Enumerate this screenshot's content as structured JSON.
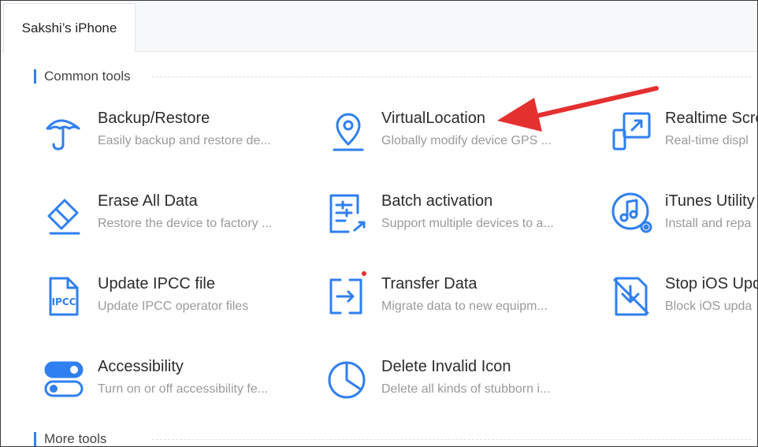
{
  "tab": {
    "label": "Sakshi’s iPhone"
  },
  "sections": {
    "common": "Common tools",
    "more": "More tools"
  },
  "colors": {
    "accent": "#2f7ff0",
    "arrow": "#e53030",
    "badge": "#e53030"
  },
  "tools": [
    {
      "title": "Backup/Restore",
      "desc": "Easily backup and restore de...",
      "icon": "umbrella-icon"
    },
    {
      "title": "VirtualLocation",
      "desc": "Globally modify device GPS ...",
      "icon": "location-pin-icon"
    },
    {
      "title": "Realtime Scre",
      "desc": "Real-time displ",
      "icon": "screen-mirror-icon"
    },
    {
      "title": "Erase All Data",
      "desc": "Restore the device to factory ...",
      "icon": "eraser-icon"
    },
    {
      "title": "Batch activation",
      "desc": "Support multiple devices to a...",
      "icon": "batch-activation-icon"
    },
    {
      "title": "iTunes Utility",
      "desc": "Install and repa",
      "icon": "music-note-icon"
    },
    {
      "title": "Update IPCC file",
      "desc": "Update IPCC operator files",
      "icon": "ipcc-file-icon",
      "icon_text": "IPCC"
    },
    {
      "title": "Transfer Data",
      "desc": "Migrate data to new equipm...",
      "icon": "transfer-icon"
    },
    {
      "title": "Stop iOS Upd",
      "desc": "Block iOS upda",
      "icon": "stop-update-icon"
    },
    {
      "title": "Accessibility",
      "desc": "Turn on or off accessibility fe...",
      "icon": "toggle-icon"
    },
    {
      "title": "Delete Invalid Icon",
      "desc": "Delete all kinds of stubborn i...",
      "icon": "pie-chart-icon"
    }
  ]
}
